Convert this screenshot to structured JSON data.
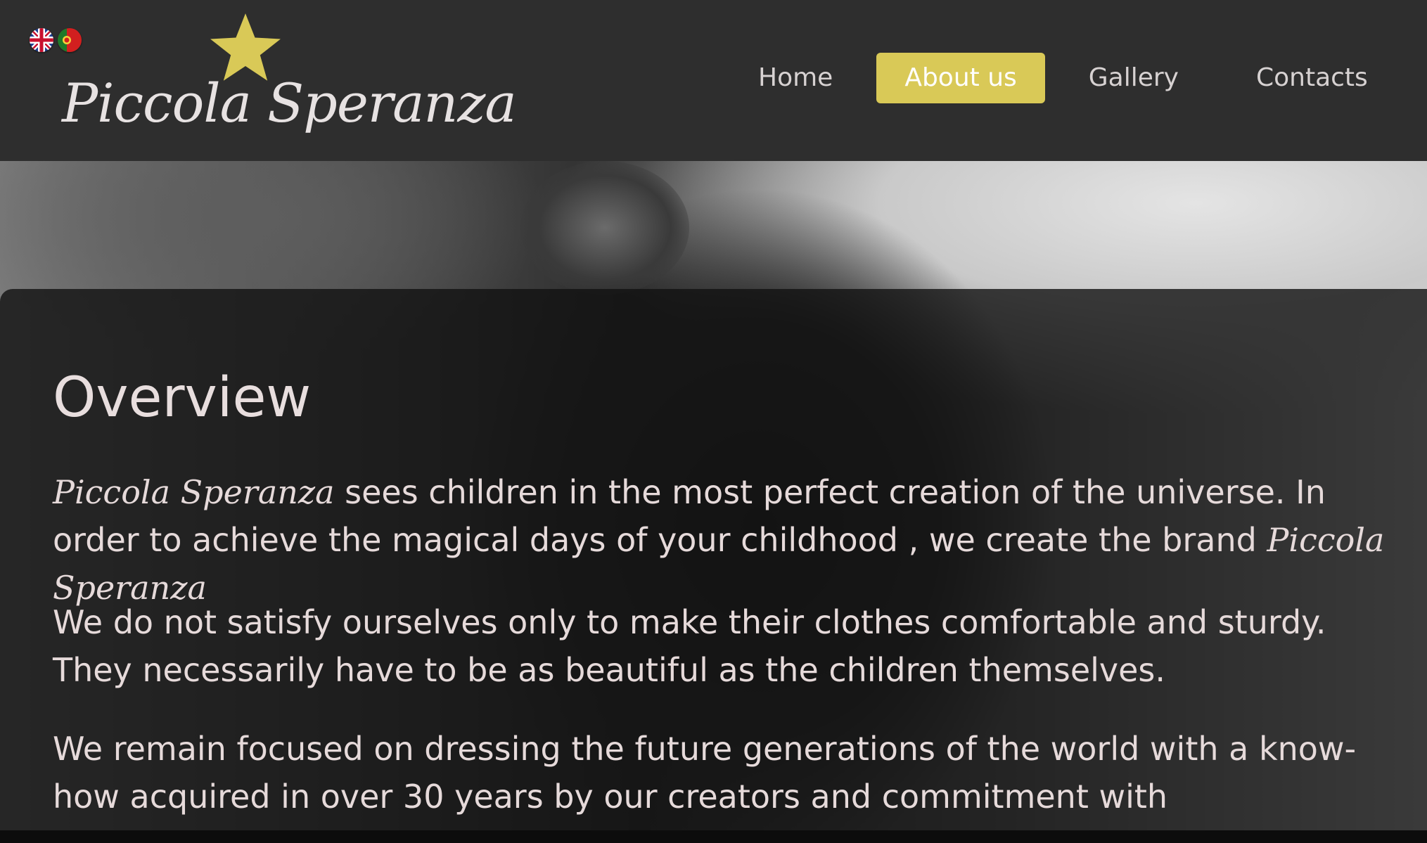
{
  "header": {
    "languages": [
      {
        "code": "en",
        "icon": "uk-flag-icon"
      },
      {
        "code": "pt",
        "icon": "portugal-flag-icon"
      }
    ],
    "logo": {
      "text": "Piccola Speranza",
      "icon": "star-icon",
      "star_color": "#d9c957"
    },
    "nav": {
      "items": [
        {
          "label": "Home",
          "active": false
        },
        {
          "label": "About us",
          "active": true
        },
        {
          "label": "Gallery",
          "active": false
        },
        {
          "label": "Contacts",
          "active": false
        }
      ],
      "active_color": "#d9c957"
    }
  },
  "main": {
    "title": "Overview",
    "brand": "Piccola Speranza",
    "paragraphs": {
      "p1_part1": " sees children in the most perfect creation of the universe. In order to achieve the magical days of your childhood , we create the brand ",
      "p2": "We do not satisfy ourselves only to make their clothes comfortable and sturdy. They necessarily have to be as beautiful as the children themselves.",
      "p3": "We remain focused on dressing the future generations of the world with a know-how acquired in over 30 years by our creators and commitment with responsibility it requires."
    }
  }
}
